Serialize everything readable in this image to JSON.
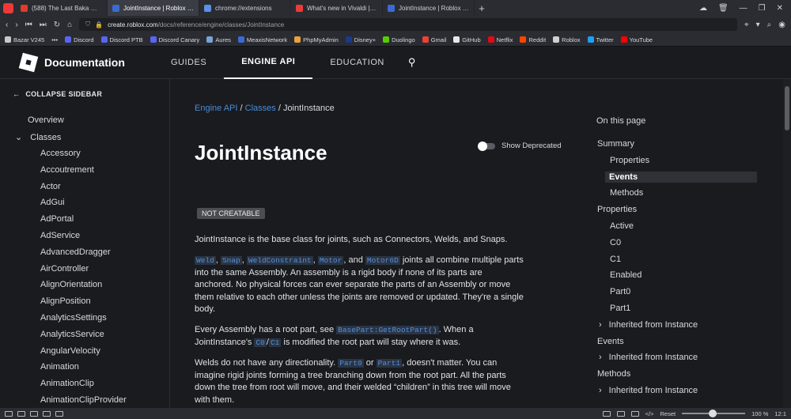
{
  "browser": {
    "tabs": [
      {
        "title": "(588) The Last Baka Mitai V",
        "color": "#e23b2e"
      },
      {
        "title": "JointInstance | Roblox Crea",
        "color": "#3a6bd4",
        "active": true
      },
      {
        "title": "chrome://extensions",
        "color": "#5d8fe8"
      },
      {
        "title": "What's new in Vivaldi | Viva",
        "color": "#ef3939"
      },
      {
        "title": "JointInstance | Roblox Crea",
        "color": "#3a6bd4"
      }
    ],
    "url_domain": "create.roblox.com",
    "url_path": "/docs/reference/engine/classes/JointInstance",
    "bookmarks": [
      {
        "label": "Bazar V245",
        "color": "#c9c9c9"
      },
      {
        "label": "Discord",
        "color": "#5865f2"
      },
      {
        "label": "Discord PTB",
        "color": "#5865f2"
      },
      {
        "label": "Discord Canary",
        "color": "#5865f2"
      },
      {
        "label": "Aures",
        "color": "#7aa3d6"
      },
      {
        "label": "MeaxisNetwork",
        "color": "#3a6bd4"
      },
      {
        "label": "PhpMyAdmin",
        "color": "#e8a23a"
      },
      {
        "label": "Disney+",
        "color": "#1a3a8c"
      },
      {
        "label": "Duolingo",
        "color": "#58cc02"
      },
      {
        "label": "Gmail",
        "color": "#ea4335"
      },
      {
        "label": "GitHub",
        "color": "#e8e8e8"
      },
      {
        "label": "Netflix",
        "color": "#e50914"
      },
      {
        "label": "Reddit",
        "color": "#ff4500"
      },
      {
        "label": "Roblox",
        "color": "#d0d0d0"
      },
      {
        "label": "Twitter",
        "color": "#1da1f2"
      },
      {
        "label": "YouTube",
        "color": "#ff0000"
      }
    ],
    "status": {
      "reset": "Reset",
      "zoom": "100 %",
      "time": "12:1"
    }
  },
  "header": {
    "title": "Documentation",
    "nav": [
      "GUIDES",
      "ENGINE API",
      "EDUCATION"
    ]
  },
  "sidebar": {
    "collapse": "COLLAPSE SIDEBAR",
    "overview": "Overview",
    "classes": "Classes",
    "items": [
      "Accessory",
      "Accoutrement",
      "Actor",
      "AdGui",
      "AdPortal",
      "AdService",
      "AdvancedDragger",
      "AirController",
      "AlignOrientation",
      "AlignPosition",
      "AnalyticsSettings",
      "AnalyticsService",
      "AngularVelocity",
      "Animation",
      "AnimationClip",
      "AnimationClipProvider"
    ]
  },
  "main": {
    "breadcrumb": {
      "engine_api": "Engine API",
      "sep": "/",
      "classes": "Classes",
      "current": "JointInstance"
    },
    "title": "JointInstance",
    "show_deprecated": "Show Deprecated",
    "badge": "NOT CREATABLE",
    "intro": "JointInstance is the base class for joints, such as Connectors, Welds, and Snaps.",
    "p1": {
      "codes": [
        "Weld",
        "Snap",
        "WeldConstraint",
        "Motor",
        "Motor6D"
      ],
      "sep": ", ",
      "and": ", and ",
      "text1": " joints all combine multiple parts",
      "text2": "into the same Assembly. An assembly is a rigid body if none of its parts are",
      "text3": "anchored. No physical forces can ever separate the parts of an Assembly or move",
      "text4": "them relative to each other unless the joints are removed or updated. They're a single",
      "text5": "body."
    },
    "p2": {
      "a": "Every Assembly has a root part, see ",
      "code1": "BasePart:GetRootPart()",
      "b": ". When a",
      "c": "JointInstance's ",
      "code2": "C0",
      "slash": "/",
      "code3": "C1",
      "d": " is modified the root part will stay where it was."
    },
    "p3": {
      "a": "Welds do not have any directionality. ",
      "code1": "Part0",
      "or": " or ",
      "code2": "Part1",
      "b": ", doesn't matter. You can",
      "c": "imagine rigid joints forming a tree branching down from the root part. All the parts",
      "d": "down the tree from root will move, and their welded “children” in this tree will move",
      "e": "with them."
    }
  },
  "toc": {
    "heading": "On this page",
    "items": [
      {
        "label": "Summary",
        "indent": false,
        "arrow": false
      },
      {
        "label": "Properties",
        "indent": true,
        "arrow": false
      },
      {
        "label": "Events",
        "indent": true,
        "arrow": false,
        "selected": true
      },
      {
        "label": "Methods",
        "indent": true,
        "arrow": false
      },
      {
        "label": "Properties",
        "indent": false,
        "arrow": false
      },
      {
        "label": "Active",
        "indent": true,
        "arrow": false
      },
      {
        "label": "C0",
        "indent": true,
        "arrow": false
      },
      {
        "label": "C1",
        "indent": true,
        "arrow": false
      },
      {
        "label": "Enabled",
        "indent": true,
        "arrow": false
      },
      {
        "label": "Part0",
        "indent": true,
        "arrow": false
      },
      {
        "label": "Part1",
        "indent": true,
        "arrow": false
      },
      {
        "label": "Inherited from Instance",
        "indent": true,
        "arrow": true
      },
      {
        "label": "Events",
        "indent": false,
        "arrow": false
      },
      {
        "label": "Inherited from Instance",
        "indent": true,
        "arrow": true
      },
      {
        "label": "Methods",
        "indent": false,
        "arrow": false
      },
      {
        "label": "Inherited from Instance",
        "indent": true,
        "arrow": true
      }
    ]
  }
}
